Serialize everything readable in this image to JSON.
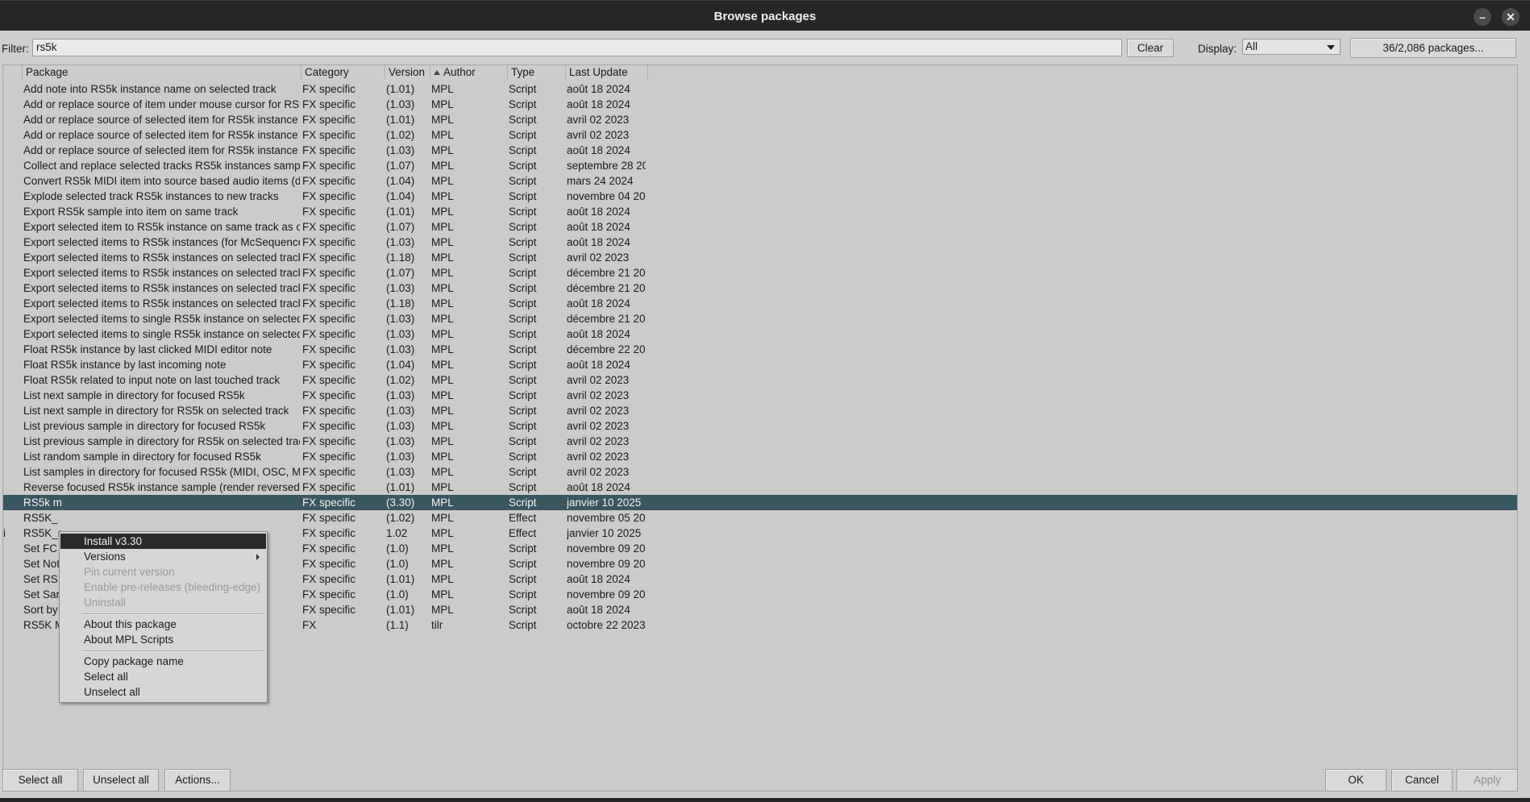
{
  "window": {
    "title": "Browse packages",
    "minimize_glyph": "–",
    "close_glyph": "✕"
  },
  "filter": {
    "label": "Filter:",
    "value": "rs5k",
    "clear_label": "Clear"
  },
  "display": {
    "label": "Display:",
    "selected": "All",
    "count_label": "36/2,086 packages..."
  },
  "columns": [
    "Package",
    "Category",
    "Version",
    "Author",
    "Type",
    "Last Update"
  ],
  "rows": [
    [
      "Add note into RS5k instance name on selected track",
      "FX specific",
      "(1.01)",
      "MPL",
      "Script",
      "août 18 2024"
    ],
    [
      "Add or replace source of item under mouse cursor for RS5",
      "FX specific",
      "(1.03)",
      "MPL",
      "Script",
      "août 18 2024"
    ],
    [
      "Add or replace source of selected item for RS5k instance",
      "FX specific",
      "(1.01)",
      "MPL",
      "Script",
      "avril 02 2023"
    ],
    [
      "Add or replace source of selected item for RS5k instance",
      "FX specific",
      "(1.02)",
      "MPL",
      "Script",
      "avril 02 2023"
    ],
    [
      "Add or replace source of selected item for RS5k instance",
      "FX specific",
      "(1.03)",
      "MPL",
      "Script",
      "août 18 2024"
    ],
    [
      "Collect and replace selected tracks RS5k instances sampl",
      "FX specific",
      "(1.07)",
      "MPL",
      "Script",
      "septembre 28 20"
    ],
    [
      "Convert RS5k MIDI item into source based audio items (dr",
      "FX specific",
      "(1.04)",
      "MPL",
      "Script",
      "mars 24 2024"
    ],
    [
      "Explode selected track RS5k instances to new tracks",
      "FX specific",
      "(1.04)",
      "MPL",
      "Script",
      "novembre 04 202"
    ],
    [
      "Export RS5k sample into item on same track",
      "FX specific",
      "(1.01)",
      "MPL",
      "Script",
      "août 18 2024"
    ],
    [
      "Export selected item to RS5k instance on same track as c",
      "FX specific",
      "(1.07)",
      "MPL",
      "Script",
      "août 18 2024"
    ],
    [
      "Export selected items to RS5k instances (for McSequence",
      "FX specific",
      "(1.03)",
      "MPL",
      "Script",
      "août 18 2024"
    ],
    [
      "Export selected items to RS5k instances on selected track",
      "FX specific",
      "(1.18)",
      "MPL",
      "Script",
      "avril 02 2023"
    ],
    [
      "Export selected items to RS5k instances on selected track",
      "FX specific",
      "(1.07)",
      "MPL",
      "Script",
      "décembre 21 202"
    ],
    [
      "Export selected items to RS5k instances on selected track",
      "FX specific",
      "(1.03)",
      "MPL",
      "Script",
      "décembre 21 202"
    ],
    [
      "Export selected items to RS5k instances on selected track",
      "FX specific",
      "(1.18)",
      "MPL",
      "Script",
      "août 18 2024"
    ],
    [
      "Export selected items to single RS5k instance on selected",
      "FX specific",
      "(1.03)",
      "MPL",
      "Script",
      "décembre 21 202"
    ],
    [
      "Export selected items to single RS5k instance on selected",
      "FX specific",
      "(1.03)",
      "MPL",
      "Script",
      "août 18 2024"
    ],
    [
      "Float RS5k instance by last clicked MIDI editor note",
      "FX specific",
      "(1.03)",
      "MPL",
      "Script",
      "décembre 22 202"
    ],
    [
      "Float RS5k instance by last incoming note",
      "FX specific",
      "(1.04)",
      "MPL",
      "Script",
      "août 18 2024"
    ],
    [
      "Float RS5k related to input note on last touched track",
      "FX specific",
      "(1.02)",
      "MPL",
      "Script",
      "avril 02 2023"
    ],
    [
      "List next sample in directory for focused RS5k",
      "FX specific",
      "(1.03)",
      "MPL",
      "Script",
      "avril 02 2023"
    ],
    [
      "List next sample in directory for RS5k on selected track",
      "FX specific",
      "(1.03)",
      "MPL",
      "Script",
      "avril 02 2023"
    ],
    [
      "List previous sample in directory for focused RS5k",
      "FX specific",
      "(1.03)",
      "MPL",
      "Script",
      "avril 02 2023"
    ],
    [
      "List previous sample in directory for RS5k on selected trac",
      "FX specific",
      "(1.03)",
      "MPL",
      "Script",
      "avril 02 2023"
    ],
    [
      "List random sample in directory for focused RS5k",
      "FX specific",
      "(1.03)",
      "MPL",
      "Script",
      "avril 02 2023"
    ],
    [
      "List samples in directory for focused RS5k (MIDI, OSC, M",
      "FX specific",
      "(1.03)",
      "MPL",
      "Script",
      "avril 02 2023"
    ],
    [
      "Reverse focused RS5k instance sample (render reversed a",
      "FX specific",
      "(1.01)",
      "MPL",
      "Script",
      "août 18 2024"
    ],
    [
      "RS5k m",
      "FX specific",
      "(3.30)",
      "MPL",
      "Script",
      "janvier 10 2025"
    ],
    [
      "RS5K_",
      "FX specific",
      "(1.02)",
      "MPL",
      "Effect",
      "novembre 05 202"
    ],
    [
      "RS5K_r",
      "FX specific",
      "1.02",
      "MPL",
      "Effect",
      "janvier 10 2025"
    ],
    [
      "Set FC",
      "FX specific",
      "(1.0)",
      "MPL",
      "Script",
      "novembre 09 202"
    ],
    [
      "Set Not",
      "FX specific",
      "(1.0)",
      "MPL",
      "Script",
      "novembre 09 202"
    ],
    [
      "Set RS",
      "FX specific",
      "(1.01)",
      "MPL",
      "Script",
      "août 18 2024"
    ],
    [
      "Set Sar",
      "FX specific",
      "(1.0)",
      "MPL",
      "Script",
      "novembre 09 202"
    ],
    [
      "Sort by",
      "FX specific",
      "(1.01)",
      "MPL",
      "Script",
      "août 18 2024"
    ],
    [
      "RS5K M",
      "FX",
      "(1.1)",
      "tilr",
      "Script",
      "octobre 22 2023"
    ]
  ],
  "row_markers": {
    "29": "i"
  },
  "context_menu": {
    "install": "Install v3.30",
    "versions": "Versions",
    "pin": "Pin current version",
    "prerelease": "Enable pre-releases (bleeding-edge)",
    "uninstall": "Uninstall",
    "about_package": "About this package",
    "about_repo": "About MPL Scripts",
    "copy_name": "Copy package name",
    "select_all": "Select all",
    "unselect_all": "Unselect all"
  },
  "footer": {
    "select_all": "Select all",
    "unselect_all": "Unselect all",
    "actions": "Actions...",
    "ok": "OK",
    "cancel": "Cancel",
    "apply": "Apply"
  }
}
